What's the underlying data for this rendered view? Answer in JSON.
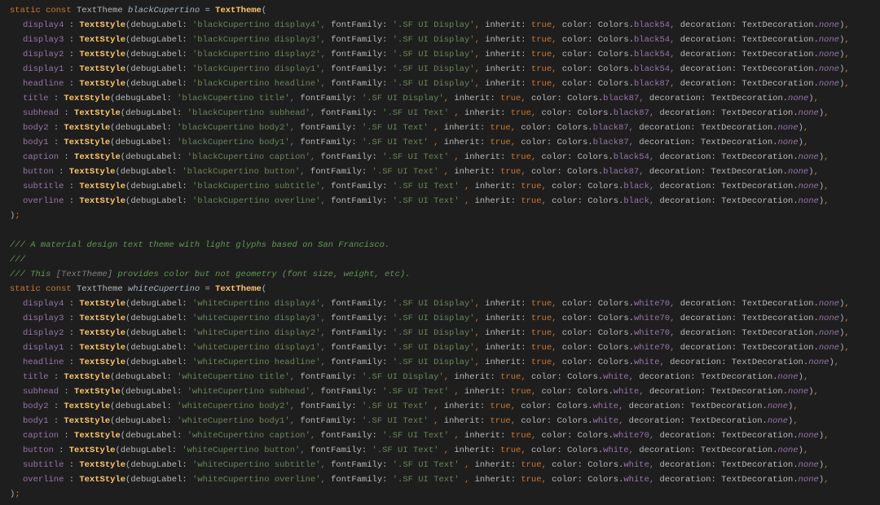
{
  "kw_static": "static",
  "kw_const": "const",
  "type_TextTheme": "TextTheme",
  "type_TextStyle": "TextStyle",
  "eq": "=",
  "open_paren": "(",
  "close_paren": ")",
  "close_paren_comma": "),",
  "semicolon_close": ");",
  "label_debugLabel": "debugLabel:",
  "label_fontFamily": "fontFamily:",
  "label_inherit": "inherit:",
  "label_color": "color:",
  "label_decoration": "decoration:",
  "kw_true": "true",
  "obj_Colors": "Colors.",
  "obj_TextDecoration": "TextDecoration.",
  "val_none": "none",
  "black": {
    "varname": "blackCupertino",
    "entries": [
      {
        "prop": "display4",
        "pad": "display4  ",
        "dbg": "'blackCupertino display4'",
        "dbgpad": "'blackCupertino display4',",
        "ff": "'.SF UI Display'",
        "color": "black54",
        "colorpad": "black54,"
      },
      {
        "prop": "display3",
        "pad": "display3  ",
        "dbg": "'blackCupertino display3'",
        "dbgpad": "'blackCupertino display3',",
        "ff": "'.SF UI Display'",
        "color": "black54",
        "colorpad": "black54,"
      },
      {
        "prop": "display2",
        "pad": "display2  ",
        "dbg": "'blackCupertino display2'",
        "dbgpad": "'blackCupertino display2',",
        "ff": "'.SF UI Display'",
        "color": "black54",
        "colorpad": "black54,"
      },
      {
        "prop": "display1",
        "pad": "display1  ",
        "dbg": "'blackCupertino display1'",
        "dbgpad": "'blackCupertino display1',",
        "ff": "'.SF UI Display'",
        "color": "black54",
        "colorpad": "black54,"
      },
      {
        "prop": "headline",
        "pad": "headline  ",
        "dbg": "'blackCupertino headline'",
        "dbgpad": "'blackCupertino headline',",
        "ff": "'.SF UI Display'",
        "color": "black87",
        "colorpad": "black87,"
      },
      {
        "prop": "title",
        "pad": "title     ",
        "dbg": "'blackCupertino title'",
        "dbgpad": "'blackCupertino title',   ",
        "ff": "'.SF UI Display'",
        "color": "black87",
        "colorpad": "black87,"
      },
      {
        "prop": "subhead",
        "pad": "subhead   ",
        "dbg": "'blackCupertino subhead'",
        "dbgpad": "'blackCupertino subhead', ",
        "ff": "'.SF UI Text'   ",
        "color": "black87",
        "colorpad": "black87,"
      },
      {
        "prop": "body2",
        "pad": "body2     ",
        "dbg": "'blackCupertino body2'",
        "dbgpad": "'blackCupertino body2',   ",
        "ff": "'.SF UI Text'   ",
        "color": "black87",
        "colorpad": "black87,"
      },
      {
        "prop": "body1",
        "pad": "body1     ",
        "dbg": "'blackCupertino body1'",
        "dbgpad": "'blackCupertino body1',   ",
        "ff": "'.SF UI Text'   ",
        "color": "black87",
        "colorpad": "black87,"
      },
      {
        "prop": "caption",
        "pad": "caption   ",
        "dbg": "'blackCupertino caption'",
        "dbgpad": "'blackCupertino caption', ",
        "ff": "'.SF UI Text'   ",
        "color": "black54",
        "colorpad": "black54,"
      },
      {
        "prop": "button",
        "pad": "button    ",
        "dbg": "'blackCupertino button'",
        "dbgpad": "'blackCupertino button',  ",
        "ff": "'.SF UI Text'   ",
        "color": "black87",
        "colorpad": "black87,"
      },
      {
        "prop": "subtitle",
        "pad": "subtitle  ",
        "dbg": "'blackCupertino subtitle'",
        "dbgpad": "'blackCupertino subtitle',",
        "ff": "'.SF UI Text'   ",
        "color": "black",
        "colorpad": "black,  "
      },
      {
        "prop": "overline",
        "pad": "overline  ",
        "dbg": "'blackCupertino overline'",
        "dbgpad": "'blackCupertino overline',",
        "ff": "'.SF UI Text'   ",
        "color": "black",
        "colorpad": "black,  "
      }
    ]
  },
  "comment1": "/// A material design text theme with light glyphs based on San Francisco.",
  "comment2": "///",
  "comment3_a": "/// This ",
  "comment3_b": "[TextTheme]",
  "comment3_c": " provides color but not geometry (font size, weight, etc).",
  "white": {
    "varname": "whiteCupertino",
    "entries": [
      {
        "prop": "display4",
        "pad": "display4  ",
        "dbg": "'whiteCupertino display4'",
        "dbgpad": "'whiteCupertino display4',",
        "ff": "'.SF UI Display'",
        "color": "white70",
        "colorpad": "white70,"
      },
      {
        "prop": "display3",
        "pad": "display3  ",
        "dbg": "'whiteCupertino display3'",
        "dbgpad": "'whiteCupertino display3',",
        "ff": "'.SF UI Display'",
        "color": "white70",
        "colorpad": "white70,"
      },
      {
        "prop": "display2",
        "pad": "display2  ",
        "dbg": "'whiteCupertino display2'",
        "dbgpad": "'whiteCupertino display2',",
        "ff": "'.SF UI Display'",
        "color": "white70",
        "colorpad": "white70,"
      },
      {
        "prop": "display1",
        "pad": "display1  ",
        "dbg": "'whiteCupertino display1'",
        "dbgpad": "'whiteCupertino display1',",
        "ff": "'.SF UI Display'",
        "color": "white70",
        "colorpad": "white70,"
      },
      {
        "prop": "headline",
        "pad": "headline  ",
        "dbg": "'whiteCupertino headline'",
        "dbgpad": "'whiteCupertino headline',",
        "ff": "'.SF UI Display'",
        "color": "white",
        "colorpad": "white,  "
      },
      {
        "prop": "title",
        "pad": "title     ",
        "dbg": "'whiteCupertino title'",
        "dbgpad": "'whiteCupertino title',   ",
        "ff": "'.SF UI Display'",
        "color": "white",
        "colorpad": "white,  "
      },
      {
        "prop": "subhead",
        "pad": "subhead   ",
        "dbg": "'whiteCupertino subhead'",
        "dbgpad": "'whiteCupertino subhead', ",
        "ff": "'.SF UI Text'   ",
        "color": "white",
        "colorpad": "white,  "
      },
      {
        "prop": "body2",
        "pad": "body2     ",
        "dbg": "'whiteCupertino body2'",
        "dbgpad": "'whiteCupertino body2',   ",
        "ff": "'.SF UI Text'   ",
        "color": "white",
        "colorpad": "white,  "
      },
      {
        "prop": "body1",
        "pad": "body1     ",
        "dbg": "'whiteCupertino body1'",
        "dbgpad": "'whiteCupertino body1',   ",
        "ff": "'.SF UI Text'   ",
        "color": "white",
        "colorpad": "white,  "
      },
      {
        "prop": "caption",
        "pad": "caption   ",
        "dbg": "'whiteCupertino caption'",
        "dbgpad": "'whiteCupertino caption', ",
        "ff": "'.SF UI Text'   ",
        "color": "white70",
        "colorpad": "white70,"
      },
      {
        "prop": "button",
        "pad": "button    ",
        "dbg": "'whiteCupertino button'",
        "dbgpad": "'whiteCupertino button',  ",
        "ff": "'.SF UI Text'   ",
        "color": "white",
        "colorpad": "white,  "
      },
      {
        "prop": "subtitle",
        "pad": "subtitle  ",
        "dbg": "'whiteCupertino subtitle'",
        "dbgpad": "'whiteCupertino subtitle',",
        "ff": "'.SF UI Text'   ",
        "color": "white",
        "colorpad": "white,  "
      },
      {
        "prop": "overline",
        "pad": "overline  ",
        "dbg": "'whiteCupertino overline'",
        "dbgpad": "'whiteCupertino overline',",
        "ff": "'.SF UI Text'   ",
        "color": "white",
        "colorpad": "white,  "
      }
    ]
  }
}
